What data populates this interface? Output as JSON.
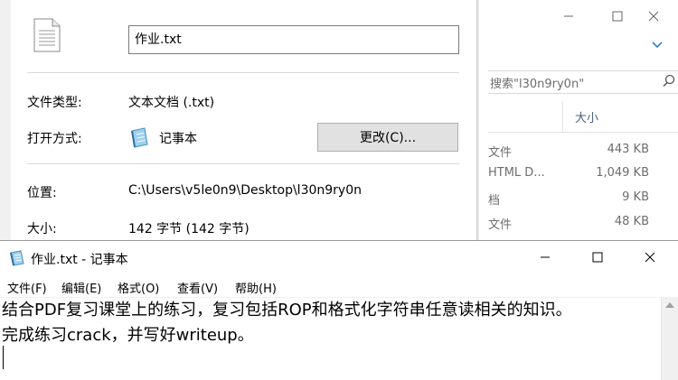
{
  "explorer": {
    "search_text": "搜索\"l30n9ry0n\"",
    "column_size": "大小",
    "rows": [
      {
        "type": "文件",
        "size": "443 KB"
      },
      {
        "type": "HTML D...",
        "size": "1,049 KB"
      },
      {
        "type": "档",
        "size": "9 KB"
      },
      {
        "type": "文件",
        "size": "48 KB"
      }
    ]
  },
  "properties": {
    "file_name": "作业.txt",
    "type_label": "文件类型:",
    "type_value": "文本文档 (.txt)",
    "opens_label": "打开方式:",
    "opens_value": "记事本",
    "change_button": "更改(C)...",
    "location_label": "位置:",
    "location_value": "C:\\Users\\v5le0n9\\Desktop\\l30n9ry0n",
    "size_label": "大小:",
    "size_value": "142 字节 (142 字节)"
  },
  "notepad": {
    "title": "作业.txt - 记事本",
    "menu": [
      "文件(F)",
      "编辑(E)",
      "格式(O)",
      "查看(V)",
      "帮助(H)"
    ],
    "lines": [
      "结合PDF复习课堂上的练习，复习包括ROP和格式化字符串任意读相关的知识。",
      "完成练习crack，并写好writeup。"
    ]
  },
  "icons": {
    "file": "text-file-icon",
    "notepad": "notepad-icon",
    "minimize": "minimize-icon",
    "maximize": "maximize-icon",
    "close": "close-icon",
    "chevron": "chevron-down-icon",
    "search": "search-icon"
  }
}
